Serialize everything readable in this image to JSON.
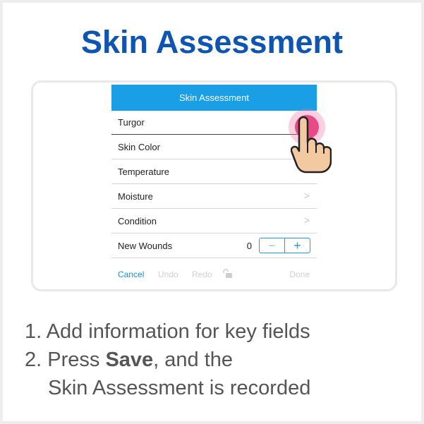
{
  "header": {
    "title": "Skin Assessment"
  },
  "screen": {
    "nav_title": "Skin Assessment",
    "rows": [
      {
        "label": "Turgor",
        "chevron": ""
      },
      {
        "label": "Skin Color",
        "chevron": ""
      },
      {
        "label": "Temperature",
        "chevron": ">"
      },
      {
        "label": "Moisture",
        "chevron": ">"
      },
      {
        "label": "Condition",
        "chevron": ">"
      }
    ],
    "wounds": {
      "label": "New Wounds",
      "value": "0",
      "minus": "−",
      "plus": "+"
    },
    "toolbar": {
      "cancel": "Cancel",
      "undo": "Undo",
      "redo": "Redo",
      "done": "Done"
    }
  },
  "steps": {
    "step1": "1. Add information for key fields",
    "step2_prefix": "2. Press ",
    "step2_bold": "Save",
    "step2_suffix": ", and the",
    "step2_line2": "Skin Assessment is recorded"
  },
  "colors": {
    "title": "#0d55b1",
    "navbar": "#1a9ee5",
    "touch": "#e84a86",
    "hand_fill": "#f2c9a0"
  },
  "icons": [
    "lock-icon",
    "chevron-right-icon",
    "hand-pointer-icon"
  ]
}
